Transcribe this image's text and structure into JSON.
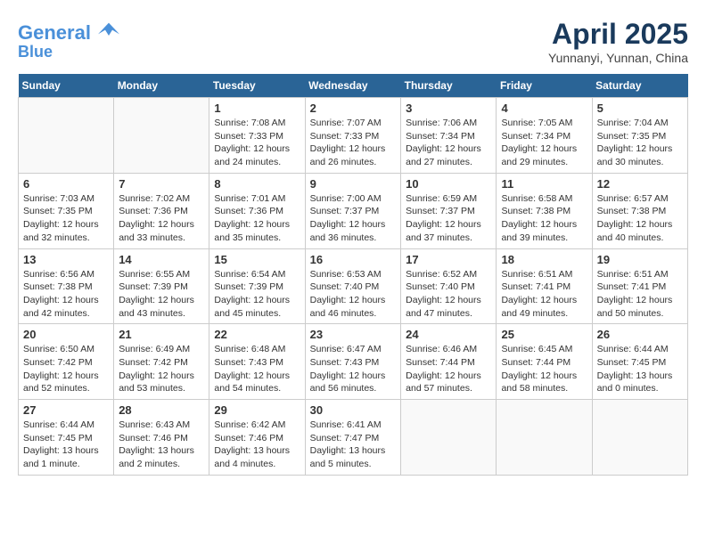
{
  "header": {
    "logo_line1": "General",
    "logo_line2": "Blue",
    "month_title": "April 2025",
    "location": "Yunnanyi, Yunnan, China"
  },
  "weekdays": [
    "Sunday",
    "Monday",
    "Tuesday",
    "Wednesday",
    "Thursday",
    "Friday",
    "Saturday"
  ],
  "weeks": [
    [
      null,
      null,
      {
        "day": "1",
        "sunrise": "7:08 AM",
        "sunset": "7:33 PM",
        "daylight": "12 hours and 24 minutes."
      },
      {
        "day": "2",
        "sunrise": "7:07 AM",
        "sunset": "7:33 PM",
        "daylight": "12 hours and 26 minutes."
      },
      {
        "day": "3",
        "sunrise": "7:06 AM",
        "sunset": "7:34 PM",
        "daylight": "12 hours and 27 minutes."
      },
      {
        "day": "4",
        "sunrise": "7:05 AM",
        "sunset": "7:34 PM",
        "daylight": "12 hours and 29 minutes."
      },
      {
        "day": "5",
        "sunrise": "7:04 AM",
        "sunset": "7:35 PM",
        "daylight": "12 hours and 30 minutes."
      }
    ],
    [
      {
        "day": "6",
        "sunrise": "7:03 AM",
        "sunset": "7:35 PM",
        "daylight": "12 hours and 32 minutes."
      },
      {
        "day": "7",
        "sunrise": "7:02 AM",
        "sunset": "7:36 PM",
        "daylight": "12 hours and 33 minutes."
      },
      {
        "day": "8",
        "sunrise": "7:01 AM",
        "sunset": "7:36 PM",
        "daylight": "12 hours and 35 minutes."
      },
      {
        "day": "9",
        "sunrise": "7:00 AM",
        "sunset": "7:37 PM",
        "daylight": "12 hours and 36 minutes."
      },
      {
        "day": "10",
        "sunrise": "6:59 AM",
        "sunset": "7:37 PM",
        "daylight": "12 hours and 37 minutes."
      },
      {
        "day": "11",
        "sunrise": "6:58 AM",
        "sunset": "7:38 PM",
        "daylight": "12 hours and 39 minutes."
      },
      {
        "day": "12",
        "sunrise": "6:57 AM",
        "sunset": "7:38 PM",
        "daylight": "12 hours and 40 minutes."
      }
    ],
    [
      {
        "day": "13",
        "sunrise": "6:56 AM",
        "sunset": "7:38 PM",
        "daylight": "12 hours and 42 minutes."
      },
      {
        "day": "14",
        "sunrise": "6:55 AM",
        "sunset": "7:39 PM",
        "daylight": "12 hours and 43 minutes."
      },
      {
        "day": "15",
        "sunrise": "6:54 AM",
        "sunset": "7:39 PM",
        "daylight": "12 hours and 45 minutes."
      },
      {
        "day": "16",
        "sunrise": "6:53 AM",
        "sunset": "7:40 PM",
        "daylight": "12 hours and 46 minutes."
      },
      {
        "day": "17",
        "sunrise": "6:52 AM",
        "sunset": "7:40 PM",
        "daylight": "12 hours and 47 minutes."
      },
      {
        "day": "18",
        "sunrise": "6:51 AM",
        "sunset": "7:41 PM",
        "daylight": "12 hours and 49 minutes."
      },
      {
        "day": "19",
        "sunrise": "6:51 AM",
        "sunset": "7:41 PM",
        "daylight": "12 hours and 50 minutes."
      }
    ],
    [
      {
        "day": "20",
        "sunrise": "6:50 AM",
        "sunset": "7:42 PM",
        "daylight": "12 hours and 52 minutes."
      },
      {
        "day": "21",
        "sunrise": "6:49 AM",
        "sunset": "7:42 PM",
        "daylight": "12 hours and 53 minutes."
      },
      {
        "day": "22",
        "sunrise": "6:48 AM",
        "sunset": "7:43 PM",
        "daylight": "12 hours and 54 minutes."
      },
      {
        "day": "23",
        "sunrise": "6:47 AM",
        "sunset": "7:43 PM",
        "daylight": "12 hours and 56 minutes."
      },
      {
        "day": "24",
        "sunrise": "6:46 AM",
        "sunset": "7:44 PM",
        "daylight": "12 hours and 57 minutes."
      },
      {
        "day": "25",
        "sunrise": "6:45 AM",
        "sunset": "7:44 PM",
        "daylight": "12 hours and 58 minutes."
      },
      {
        "day": "26",
        "sunrise": "6:44 AM",
        "sunset": "7:45 PM",
        "daylight": "13 hours and 0 minutes."
      }
    ],
    [
      {
        "day": "27",
        "sunrise": "6:44 AM",
        "sunset": "7:45 PM",
        "daylight": "13 hours and 1 minute."
      },
      {
        "day": "28",
        "sunrise": "6:43 AM",
        "sunset": "7:46 PM",
        "daylight": "13 hours and 2 minutes."
      },
      {
        "day": "29",
        "sunrise": "6:42 AM",
        "sunset": "7:46 PM",
        "daylight": "13 hours and 4 minutes."
      },
      {
        "day": "30",
        "sunrise": "6:41 AM",
        "sunset": "7:47 PM",
        "daylight": "13 hours and 5 minutes."
      },
      null,
      null,
      null
    ]
  ]
}
